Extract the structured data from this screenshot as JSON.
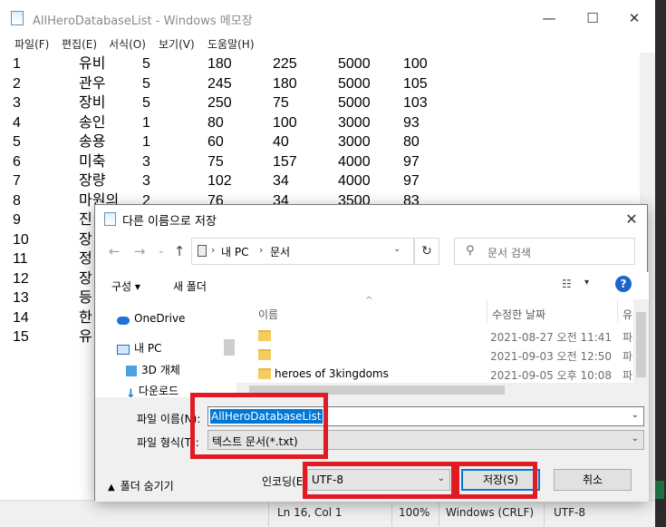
{
  "notepad": {
    "title": "AllHeroDatabaseList - Windows 메모장",
    "menu": [
      "파일(F)",
      "편집(E)",
      "서식(O)",
      "보기(V)",
      "도움말(H)"
    ],
    "rows": [
      [
        "1",
        "유비",
        "5",
        "180",
        "225",
        "5000",
        "100"
      ],
      [
        "2",
        "관우",
        "5",
        "245",
        "180",
        "5000",
        "105"
      ],
      [
        "3",
        "장비",
        "5",
        "250",
        "75",
        "5000",
        "103"
      ],
      [
        "4",
        "송인",
        "1",
        "80",
        "100",
        "3000",
        "93"
      ],
      [
        "5",
        "송용",
        "1",
        "60",
        "40",
        "3000",
        "80"
      ],
      [
        "6",
        "미축",
        "3",
        "75",
        "157",
        "4000",
        "97"
      ],
      [
        "7",
        "장량",
        "3",
        "102",
        "34",
        "4000",
        "97"
      ],
      [
        "8",
        "마원의",
        "2",
        "76",
        "34",
        "3500",
        "83"
      ],
      [
        "9",
        "진",
        "",
        "",
        "",
        "",
        ""
      ],
      [
        "10",
        "장",
        "",
        "",
        "",
        "",
        ""
      ],
      [
        "11",
        "정",
        "",
        "",
        "",
        "",
        ""
      ],
      [
        "12",
        "장",
        "",
        "",
        "",
        "",
        ""
      ],
      [
        "13",
        "등",
        "",
        "",
        "",
        "",
        ""
      ],
      [
        "14",
        "한",
        "",
        "",
        "",
        "",
        ""
      ],
      [
        "15",
        "유",
        "",
        "",
        "",
        "",
        ""
      ]
    ],
    "status": {
      "position": "Ln 16, Col 1",
      "zoom": "100%",
      "line_ending": "Windows (CRLF)",
      "encoding": "UTF-8"
    }
  },
  "dialog": {
    "title": "다른 이름으로 저장",
    "breadcrumb": [
      "내 PC",
      "문서"
    ],
    "search_placeholder": "문서 검색",
    "toolbar": {
      "organize": "구성 ▾",
      "new_folder": "새 폴더"
    },
    "nav_items": [
      {
        "label": "OneDrive",
        "icon": "cloud-icon"
      },
      {
        "label": "내 PC",
        "icon": "computer-icon"
      },
      {
        "label": "3D 개체",
        "icon": "cube-icon"
      },
      {
        "label": "다운로드",
        "icon": "download-icon"
      }
    ],
    "columns": {
      "name": "이름",
      "date": "수정한 날짜",
      "type": "유"
    },
    "files": [
      {
        "name": "",
        "date": "2021-08-27 오전 11:41",
        "type": "파"
      },
      {
        "name": "",
        "date": "2021-09-03 오전 12:50",
        "type": "파"
      },
      {
        "name": "heroes of 3kingdoms",
        "date": "2021-09-05 오후 10:08",
        "type": "파"
      }
    ],
    "filename_label": "파일 이름(N):",
    "filename_value": "AllHeroDatabaseList",
    "filetype_label": "파일 형식(T):",
    "filetype_value": "텍스트 문서(*.txt)",
    "hide_folders": "폴더 숨기기",
    "encoding_label": "인코딩(E):",
    "encoding_value": "UTF-8",
    "save_label": "저장(S)",
    "cancel_label": "취소"
  },
  "colors": {
    "highlight": "#e01b24",
    "accent": "#0078d7"
  }
}
